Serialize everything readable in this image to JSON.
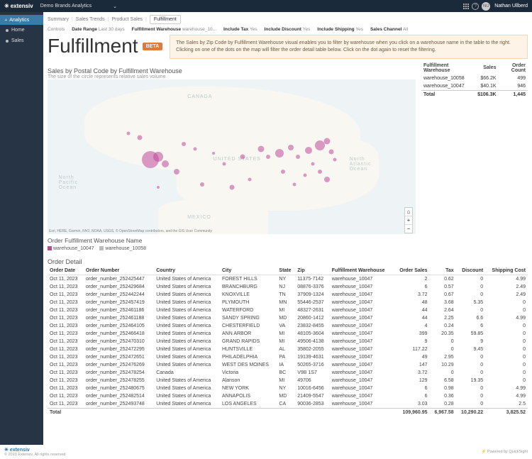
{
  "topbar": {
    "logo": "extensiv",
    "brand": "Demo Brands Analytics",
    "user_initials": "NU",
    "user_name": "Nathan Ullberd"
  },
  "sidebar": {
    "head": "Analytics",
    "items": [
      "Home",
      "Sales"
    ]
  },
  "tabs": [
    "Summary",
    "Sales Trends",
    "Product Sales",
    "Fulfillment"
  ],
  "controls": {
    "label": "Controls",
    "date_label": "Date Range",
    "date_val": "Last 30 days",
    "wh_label": "Fulfillment Warehouse",
    "wh_val": "warehouse_10...",
    "tax_label": "Include Tax",
    "tax_val": "Yes",
    "disc_label": "Include Discount",
    "disc_val": "Yes",
    "ship_label": "Include Shipping",
    "ship_val": "Yes",
    "chan_label": "Sales Channel",
    "chan_val": "All"
  },
  "page": {
    "title": "Fulfillment",
    "beta": "BETA",
    "info": "The Sales by Zip Code by Fulfillment Warehouse visual enables you to filter by warehouse when you click on a warehouse name in the table to the right. Clicking on one of the dots on the map will filter the order detail table below. Click on the dot again to reset the filtering.",
    "section_title": "Sales by Postal Code by Fulfillment Warehouse",
    "section_sub": "The size of the circle represents relative sales volume",
    "labels": {
      "canada": "CANADA",
      "usa": "UNITED STATES",
      "na": "North Atlantic Ocean",
      "np": "North Pacific Ocean",
      "mex": "MEXICO"
    },
    "map_attr": "Esri, HERE, Garmin, FAO, NOAA, USGS, © OpenStreetMap contributors, and the GIS User Community",
    "legend_title": "Order Fulfillment Warehouse Name",
    "legend": [
      "warehouse_10047",
      "warehouse_10058"
    ],
    "detail_title": "Order Detail"
  },
  "wh_summary": {
    "headers": [
      "Fulfillment Warehouse",
      "Sales",
      "Order Count"
    ],
    "rows": [
      [
        "warehouse_10058",
        "$66.2K",
        "499"
      ],
      [
        "warehouse_10047",
        "$40.1K",
        "946"
      ]
    ],
    "total": [
      "Total",
      "$106.3K",
      "1,445"
    ]
  },
  "detail": {
    "headers": [
      "Order Date",
      "Order Number",
      "Country",
      "City",
      "State",
      "Zip",
      "Fulfillment Warehouse",
      "Order Sales",
      "Tax",
      "Discount",
      "Shipping Cost"
    ],
    "rows": [
      [
        "Oct 11, 2023",
        "order_number_252425447",
        "United States of America",
        "FOREST HILLS",
        "NY",
        "11375-7142",
        "warehouse_10047",
        "2",
        "0.62",
        "0",
        "4.99"
      ],
      [
        "Oct 11, 2023",
        "order_number_252429684",
        "United States of America",
        "BRANCHBURG",
        "NJ",
        "08876-3376",
        "warehouse_10047",
        "6",
        "0.57",
        "0",
        "2.49"
      ],
      [
        "Oct 11, 2023",
        "order_number_252442244",
        "United States of America",
        "KNOXVILLE",
        "TN",
        "37909-1324",
        "warehouse_10047",
        "3.72",
        "0.67",
        "0",
        "2.49"
      ],
      [
        "Oct 11, 2023",
        "order_number_252457419",
        "United States of America",
        "PLYMOUTH",
        "MN",
        "55446-2537",
        "warehouse_10047",
        "48",
        "3.68",
        "5.35",
        "0"
      ],
      [
        "Oct 11, 2023",
        "order_number_252461186",
        "United States of America",
        "WATERFORD",
        "MI",
        "48327-2631",
        "warehouse_10047",
        "44",
        "2.64",
        "0",
        "0"
      ],
      [
        "Oct 11, 2023",
        "order_number_252461188",
        "United States of America",
        "SANDY SPRING",
        "MD",
        "20860-1412",
        "warehouse_10047",
        "44",
        "2.25",
        "6.6",
        "4.99"
      ],
      [
        "Oct 11, 2023",
        "order_number_252464105",
        "United States of America",
        "CHESTERFIELD",
        "VA",
        "23832-8455",
        "warehouse_10047",
        "4",
        "0.24",
        "6",
        "0"
      ],
      [
        "Oct 11, 2023",
        "order_number_252466418",
        "United States of America",
        "ANN ARBOR",
        "MI",
        "48105-3604",
        "warehouse_10047",
        "399",
        "20.35",
        "59.85",
        "0"
      ],
      [
        "Oct 11, 2023",
        "order_number_252470310",
        "United States of America",
        "GRAND RAPIDS",
        "MI",
        "49506-4138",
        "warehouse_10047",
        "9",
        "0",
        "9",
        "0"
      ],
      [
        "Oct 11, 2023",
        "order_number_252472295",
        "United States of America",
        "HUNTSVILLE",
        "AL",
        "35802-2055",
        "warehouse_10047",
        "117.22",
        "0",
        "9.45",
        "0"
      ],
      [
        "Oct 11, 2023",
        "order_number_252472651",
        "United States of America",
        "PHILADELPHIA",
        "PA",
        "19139-4631",
        "warehouse_10047",
        "49",
        "2.95",
        "0",
        "0"
      ],
      [
        "Oct 11, 2023",
        "order_number_252476269",
        "United States of America",
        "WEST DES MOINES",
        "IA",
        "50265-3716",
        "warehouse_10047",
        "147",
        "10.29",
        "0",
        "0"
      ],
      [
        "Oct 11, 2023",
        "order_number_252478254",
        "Canada",
        "Victoria",
        "BC",
        "V9B 1S7",
        "warehouse_10047",
        "3.72",
        "0",
        "0",
        "0"
      ],
      [
        "Oct 11, 2023",
        "order_number_252478255",
        "United States of America",
        "Alanson",
        "MI",
        "49706",
        "warehouse_10047",
        "129",
        "6.58",
        "19.35",
        "0"
      ],
      [
        "Oct 11, 2023",
        "order_number_252480675",
        "United States of America",
        "NEW YORK",
        "NY",
        "10016-6456",
        "warehouse_10047",
        "6",
        "0.98",
        "0",
        "4.99"
      ],
      [
        "Oct 11, 2023",
        "order_number_252482514",
        "United States of America",
        "ANNAPOLIS",
        "MD",
        "21409-5547",
        "warehouse_10047",
        "6",
        "0.36",
        "0",
        "4.99"
      ],
      [
        "Oct 11, 2023",
        "order_number_252493748",
        "United States of America",
        "LOS ANGELES",
        "CA",
        "90036-2853",
        "warehouse_10047",
        "3.03",
        "0.28",
        "0",
        "2.5"
      ]
    ],
    "total": [
      "Total",
      "",
      "",
      "",
      "",
      "",
      "",
      "109,960.95",
      "6,967.58",
      "10,290.22",
      "3,825.52"
    ]
  },
  "footer": {
    "logo": "extensiv",
    "copyright": "© 2023 Extensiv, All rights reserved",
    "powered": "Powered by QuickSight"
  }
}
